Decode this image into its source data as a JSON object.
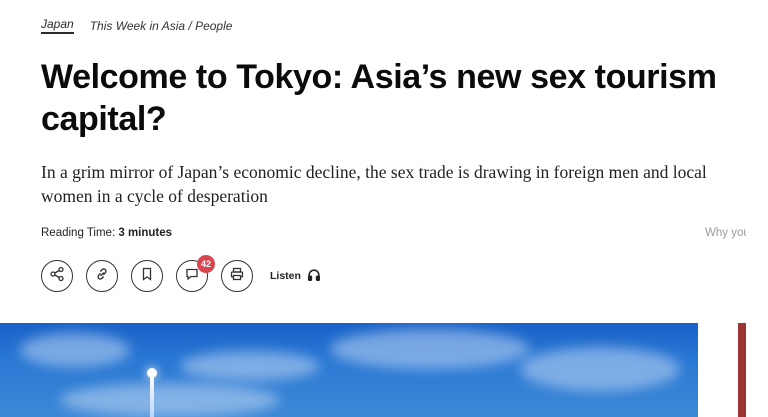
{
  "breadcrumbs": {
    "primary": "Japan",
    "secondary": "This Week in Asia / People"
  },
  "article": {
    "title": "Welcome to Tokyo: Asia’s new sex tourism capital?",
    "subtitle": "In a grim mirror of Japan’s economic decline, the sex trade is drawing in foreign men and local women in a cycle of desperation",
    "reading_label": "Reading Time: ",
    "reading_value": "3 minutes",
    "why_text": "Why you"
  },
  "toolbar": {
    "comment_count": "42",
    "listen_label": "Listen",
    "icons": [
      "share-icon",
      "link-icon",
      "bookmark-icon",
      "comment-icon",
      "print-icon",
      "headphones-icon"
    ]
  },
  "colors": {
    "accent": "#d8454f",
    "hero_sky": "#2a78d4",
    "sidebar_strip": "#9b3532"
  }
}
